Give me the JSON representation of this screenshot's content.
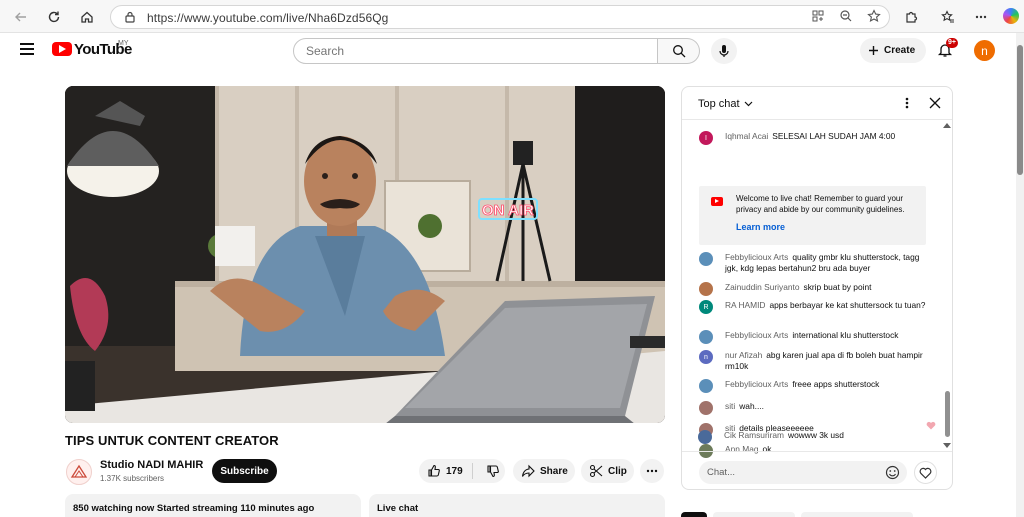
{
  "browser": {
    "url": "https://www.youtube.com/live/Nha6Dzd56Qg"
  },
  "header": {
    "logo_text": "YouTube",
    "region": "MY",
    "search_placeholder": "Search",
    "create_label": "Create",
    "notifications_badge": "9+",
    "avatar_initial": "n"
  },
  "video": {
    "overlay_sign": "ON AIR",
    "title": "TIPS UNTUK CONTENT CREATOR",
    "channel_name": "Studio NADI MAHIR",
    "subscribers": "1.37K subscribers",
    "subscribe_label": "Subscribe",
    "like_count": "179",
    "share_label": "Share",
    "clip_label": "Clip",
    "stats": "850 watching now  Started streaming 110 minutes ago",
    "live_chat_label": "Live chat"
  },
  "chat": {
    "mode": "Top chat",
    "notice_text": "Welcome to live chat! Remember to guard your privacy and abide by our community guidelines.",
    "notice_link": "Learn more",
    "input_placeholder": "Chat...",
    "messages": [
      {
        "author": "Iqhmal Acai",
        "text": "SELESAI LAH SUDAH JAM 4:00",
        "avatar_color": "#c2185b",
        "initial": "I"
      },
      {
        "author": "Febbylicioux Arts",
        "text": "quality gmbr klu shutterstock, tagg jgk, kdg lepas bertahun2 bru ada buyer",
        "avatar_color": "#5b8fb9",
        "initial": ""
      },
      {
        "author": "Zainuddin Suriyanto",
        "text": "skrip buat by point",
        "avatar_color": "#b5734a",
        "initial": ""
      },
      {
        "author": "RA HAMID",
        "text": "apps berbayar ke kat shuttersock tu tuan?",
        "avatar_color": "#00897b",
        "initial": "R"
      },
      {
        "author": "Febbylicioux Arts",
        "text": "international klu shutterstock",
        "avatar_color": "#5b8fb9",
        "initial": ""
      },
      {
        "author": "nur Afizah",
        "text": "abg karen jual apa di fb boleh buat hampir rm10k",
        "avatar_color": "#5c6bc0",
        "initial": "n"
      },
      {
        "author": "Febbylicioux Arts",
        "text": "freee apps shutterstock",
        "avatar_color": "#5b8fb9",
        "initial": ""
      },
      {
        "author": "siti",
        "text": "wah....",
        "avatar_color": "#a0726a",
        "initial": ""
      },
      {
        "author": "siti",
        "text": "details pleaseeeeee",
        "avatar_color": "#a0726a",
        "initial": ""
      },
      {
        "author": "Ann Mag",
        "text": "ok",
        "avatar_color": "#6d7b5a",
        "initial": ""
      },
      {
        "author": "Cik Ramsuriram",
        "text": "wowww 3k usd",
        "avatar_color": "#4a6a9a",
        "initial": ""
      }
    ]
  }
}
